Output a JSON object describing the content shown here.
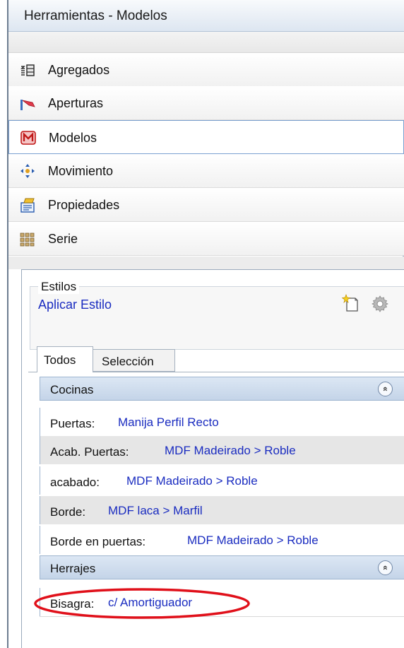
{
  "panel": {
    "title": "Herramientas - Modelos"
  },
  "nav": {
    "items": [
      {
        "label": "Agregados",
        "icon": "aggregates-icon"
      },
      {
        "label": "Aperturas",
        "icon": "openings-icon"
      },
      {
        "label": "Modelos",
        "icon": "models-icon",
        "active": true
      },
      {
        "label": "Movimiento",
        "icon": "move-icon"
      },
      {
        "label": "Propiedades",
        "icon": "properties-icon"
      },
      {
        "label": "Serie",
        "icon": "series-icon"
      }
    ]
  },
  "styles": {
    "group_title": "Estilos",
    "apply_label": "Aplicar Estilo",
    "new_icon": "new-style-icon",
    "settings_icon": "gear-icon"
  },
  "tabs": [
    {
      "label": "Todos",
      "selected": true
    },
    {
      "label": "Selección",
      "selected": false
    }
  ],
  "categories": [
    {
      "title": "Cocinas",
      "collapse_glyph": "«",
      "rows": [
        {
          "name": "Puertas:",
          "value": "Manija Perfil Recto"
        },
        {
          "name": "Acab. Puertas:",
          "value": "MDF Madeirado > Roble"
        },
        {
          "name": "acabado:",
          "value": "MDF Madeirado > Roble"
        },
        {
          "name": "Borde:",
          "value": "MDF laca > Marfil"
        },
        {
          "name": "Borde en puertas:",
          "value": "MDF Madeirado > Roble"
        }
      ]
    },
    {
      "title": "Herrajes",
      "collapse_glyph": "«",
      "rows": [
        {
          "name": "Bisagra:",
          "value": "c/ Amortiguador",
          "highlighted": true
        }
      ]
    }
  ],
  "colors": {
    "link": "#1a2cc0",
    "highlight": "#e0101a",
    "header": "#c4d4e8"
  }
}
